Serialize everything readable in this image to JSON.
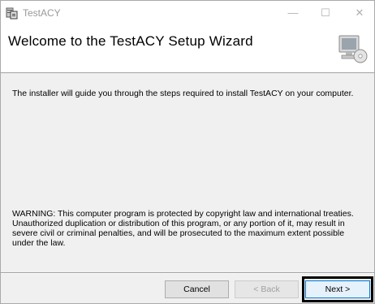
{
  "window": {
    "title": "TestACY",
    "controls": {
      "minimize": "—",
      "maximize": "☐",
      "close": "✕"
    }
  },
  "banner": {
    "title": "Welcome to the TestACY Setup Wizard",
    "icon": "computer-disc-icon"
  },
  "content": {
    "intro": "The installer will guide you through the steps required to install TestACY on your computer.",
    "warning": "WARNING: This computer program is protected by copyright law and international treaties. Unauthorized duplication or distribution of this program, or any portion of it, may result in severe civil or criminal penalties, and will be prosecuted to the maximum extent possible under the law."
  },
  "buttons": {
    "cancel": "Cancel",
    "back": "< Back",
    "next": "Next >"
  }
}
